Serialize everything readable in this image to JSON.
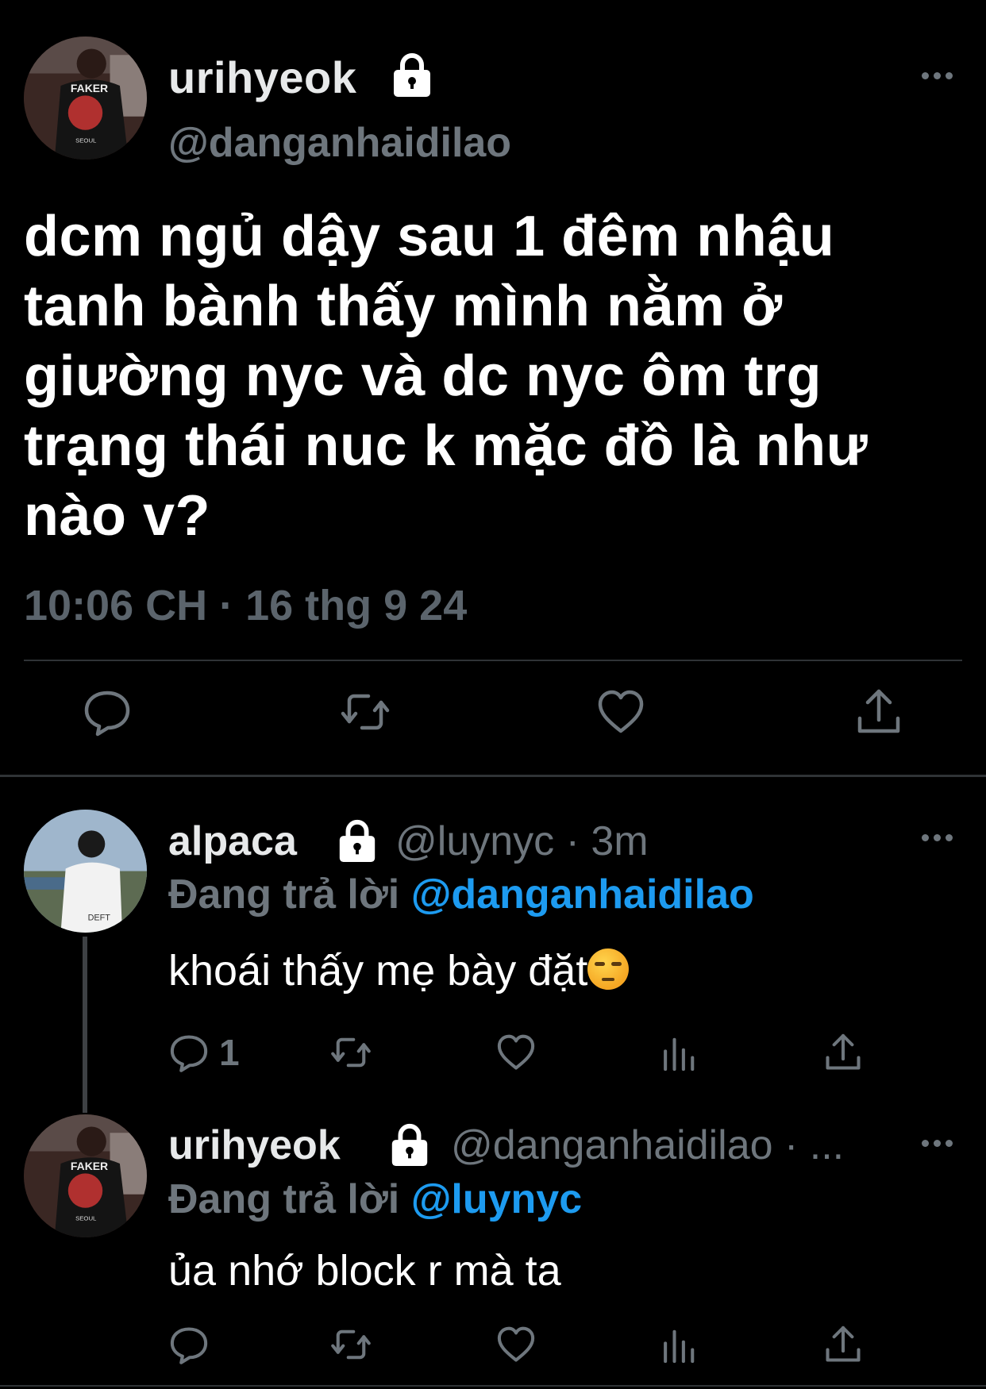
{
  "main_tweet": {
    "display_name": "urihyeok",
    "handle": "@danganhaidilao",
    "text": "dcm ngủ dậy sau 1 đêm nhậu tanh bành thấy mình nằm ở giường nyc và dc nyc ôm trg trạng thái nuc k mặc đồ là như nào v?",
    "timestamp": "10:06 CH · 16 thg 9 24",
    "icons": [
      "lock-icon",
      "more-icon",
      "reply-icon",
      "retweet-icon",
      "like-icon",
      "share-icon"
    ]
  },
  "replies": [
    {
      "display_name": "alpaca",
      "handle": "@luynyc · 3m",
      "replying_prefix": "Đang trả lời ",
      "replying_to": "@danganhaidilao",
      "text": "khoái thấy mẹ bày đặt",
      "emoji": "unamused-face",
      "reply_count": "1"
    },
    {
      "display_name": "urihyeok",
      "handle": "@danganhaidilao · ...",
      "replying_prefix": "Đang trả lời ",
      "replying_to": "@luynyc",
      "text": "ủa nhớ block r mà ta",
      "reply_count": ""
    }
  ],
  "colors": {
    "background": "#000000",
    "text": "#e7e9ea",
    "secondary": "#6e767d",
    "link": "#1d9bf0",
    "divider": "#2f3336"
  }
}
